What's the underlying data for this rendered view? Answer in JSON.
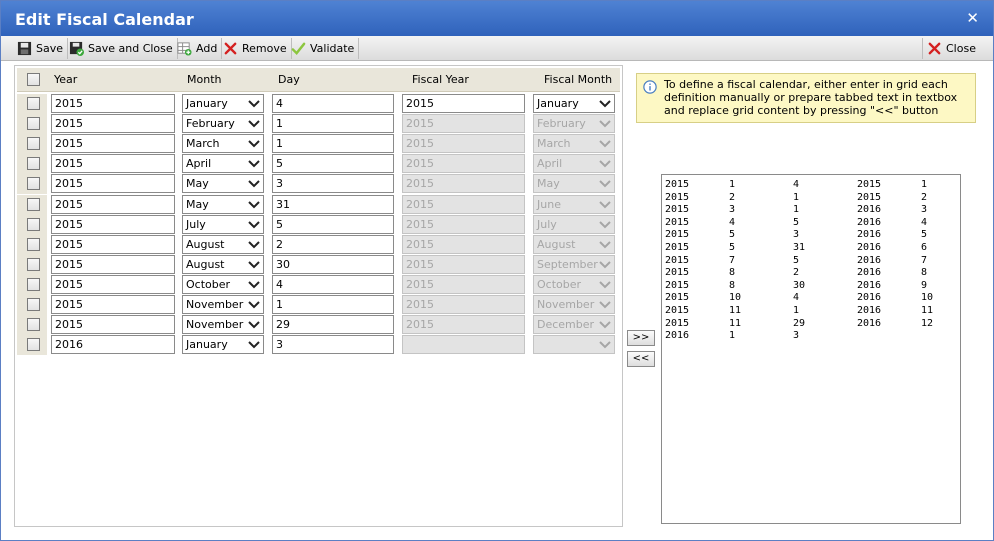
{
  "dialog": {
    "title": "Edit Fiscal Calendar",
    "close_glyph": "✕"
  },
  "toolbar": {
    "save": "Save",
    "save_close": "Save and Close",
    "add": "Add",
    "remove": "Remove",
    "validate": "Validate",
    "close": "Close"
  },
  "grid": {
    "headers": {
      "year": "Year",
      "month": "Month",
      "day": "Day",
      "fiscal_year": "Fiscal Year",
      "fiscal_month": "Fiscal Month"
    },
    "rows": [
      {
        "year": "2015",
        "month": "January",
        "day": "4",
        "fiscal_year": "2015",
        "fiscal_month": "January",
        "fiscal_disabled": false
      },
      {
        "year": "2015",
        "month": "February",
        "day": "1",
        "fiscal_year": "2015",
        "fiscal_month": "February",
        "fiscal_disabled": true
      },
      {
        "year": "2015",
        "month": "March",
        "day": "1",
        "fiscal_year": "2015",
        "fiscal_month": "March",
        "fiscal_disabled": true
      },
      {
        "year": "2015",
        "month": "April",
        "day": "5",
        "fiscal_year": "2015",
        "fiscal_month": "April",
        "fiscal_disabled": true
      },
      {
        "year": "2015",
        "month": "May",
        "day": "3",
        "fiscal_year": "2015",
        "fiscal_month": "May",
        "fiscal_disabled": true
      },
      {
        "year": "2015",
        "month": "May",
        "day": "31",
        "fiscal_year": "2015",
        "fiscal_month": "June",
        "fiscal_disabled": true
      },
      {
        "year": "2015",
        "month": "July",
        "day": "5",
        "fiscal_year": "2015",
        "fiscal_month": "July",
        "fiscal_disabled": true
      },
      {
        "year": "2015",
        "month": "August",
        "day": "2",
        "fiscal_year": "2015",
        "fiscal_month": "August",
        "fiscal_disabled": true
      },
      {
        "year": "2015",
        "month": "August",
        "day": "30",
        "fiscal_year": "2015",
        "fiscal_month": "September",
        "fiscal_disabled": true
      },
      {
        "year": "2015",
        "month": "October",
        "day": "4",
        "fiscal_year": "2015",
        "fiscal_month": "October",
        "fiscal_disabled": true
      },
      {
        "year": "2015",
        "month": "November",
        "day": "1",
        "fiscal_year": "2015",
        "fiscal_month": "November",
        "fiscal_disabled": true
      },
      {
        "year": "2015",
        "month": "November",
        "day": "29",
        "fiscal_year": "2015",
        "fiscal_month": "December",
        "fiscal_disabled": true
      },
      {
        "year": "2016",
        "month": "January",
        "day": "3",
        "fiscal_year": "",
        "fiscal_month": "",
        "fiscal_disabled": true
      }
    ]
  },
  "info": {
    "text": "To define a fiscal calendar, either enter in grid each definition manually or prepare tabbed text in textbox and replace grid content by pressing \"<<\" button"
  },
  "transfer": {
    "to_text": ">>",
    "to_grid": "<<"
  },
  "textbox": {
    "lines": [
      [
        "2015",
        "1",
        "4",
        "2015",
        "1"
      ],
      [
        "2015",
        "2",
        "1",
        "2015",
        "2"
      ],
      [
        "2015",
        "3",
        "1",
        "2016",
        "3"
      ],
      [
        "2015",
        "4",
        "5",
        "2016",
        "4"
      ],
      [
        "2015",
        "5",
        "3",
        "2016",
        "5"
      ],
      [
        "2015",
        "5",
        "31",
        "2016",
        "6"
      ],
      [
        "2015",
        "7",
        "5",
        "2016",
        "7"
      ],
      [
        "2015",
        "8",
        "2",
        "2016",
        "8"
      ],
      [
        "2015",
        "8",
        "30",
        "2016",
        "9"
      ],
      [
        "2015",
        "10",
        "4",
        "2016",
        "10"
      ],
      [
        "2015",
        "11",
        "1",
        "2016",
        "11"
      ],
      [
        "2015",
        "11",
        "29",
        "2016",
        "12"
      ],
      [
        "2016",
        "1",
        "3",
        "",
        ""
      ]
    ]
  },
  "colors": {
    "title_bar": "#3a6ec6",
    "info_bg": "#fdf8c4",
    "grid_header_bg": "#e9e6da"
  }
}
